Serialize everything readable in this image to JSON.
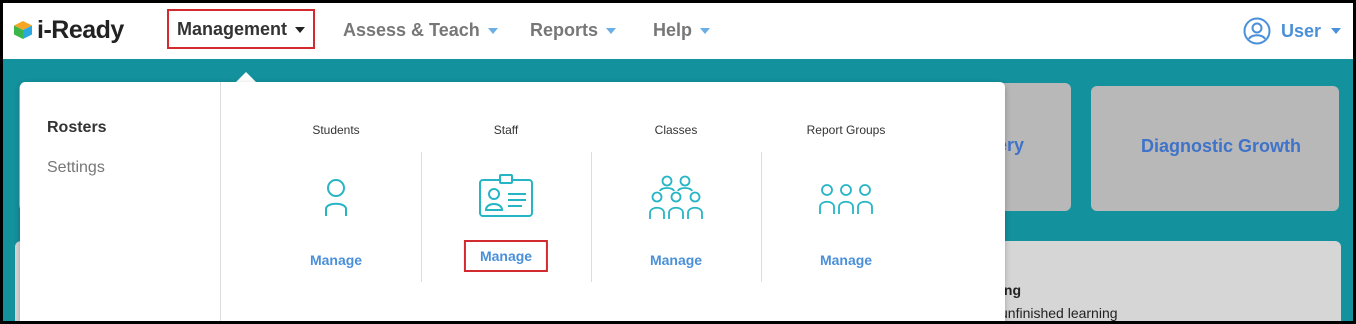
{
  "app": {
    "logo_text": "i-Ready"
  },
  "nav": {
    "items": [
      {
        "label": "Management"
      },
      {
        "label": "Assess & Teach"
      },
      {
        "label": "Reports"
      },
      {
        "label": "Help"
      }
    ],
    "user_label": "User"
  },
  "cards": {
    "partial_label": "ery",
    "diagnostic_growth": "Diagnostic Growth",
    "lower_partial_heading": "ing",
    "lower_partial_text": "unfinished learning"
  },
  "dropdown": {
    "sidebar": [
      {
        "label": "Rosters"
      },
      {
        "label": "Settings"
      }
    ],
    "columns": [
      {
        "title": "Students",
        "action": "Manage",
        "icon": "student-icon"
      },
      {
        "title": "Staff",
        "action": "Manage",
        "icon": "staff-badge-icon"
      },
      {
        "title": "Classes",
        "action": "Manage",
        "icon": "classes-icon"
      },
      {
        "title": "Report Groups",
        "action": "Manage",
        "icon": "report-groups-icon"
      }
    ]
  },
  "colors": {
    "accent": "#4a90d9",
    "teal": "#13919c",
    "highlight": "#d32a30",
    "icon": "#26b5c5"
  }
}
